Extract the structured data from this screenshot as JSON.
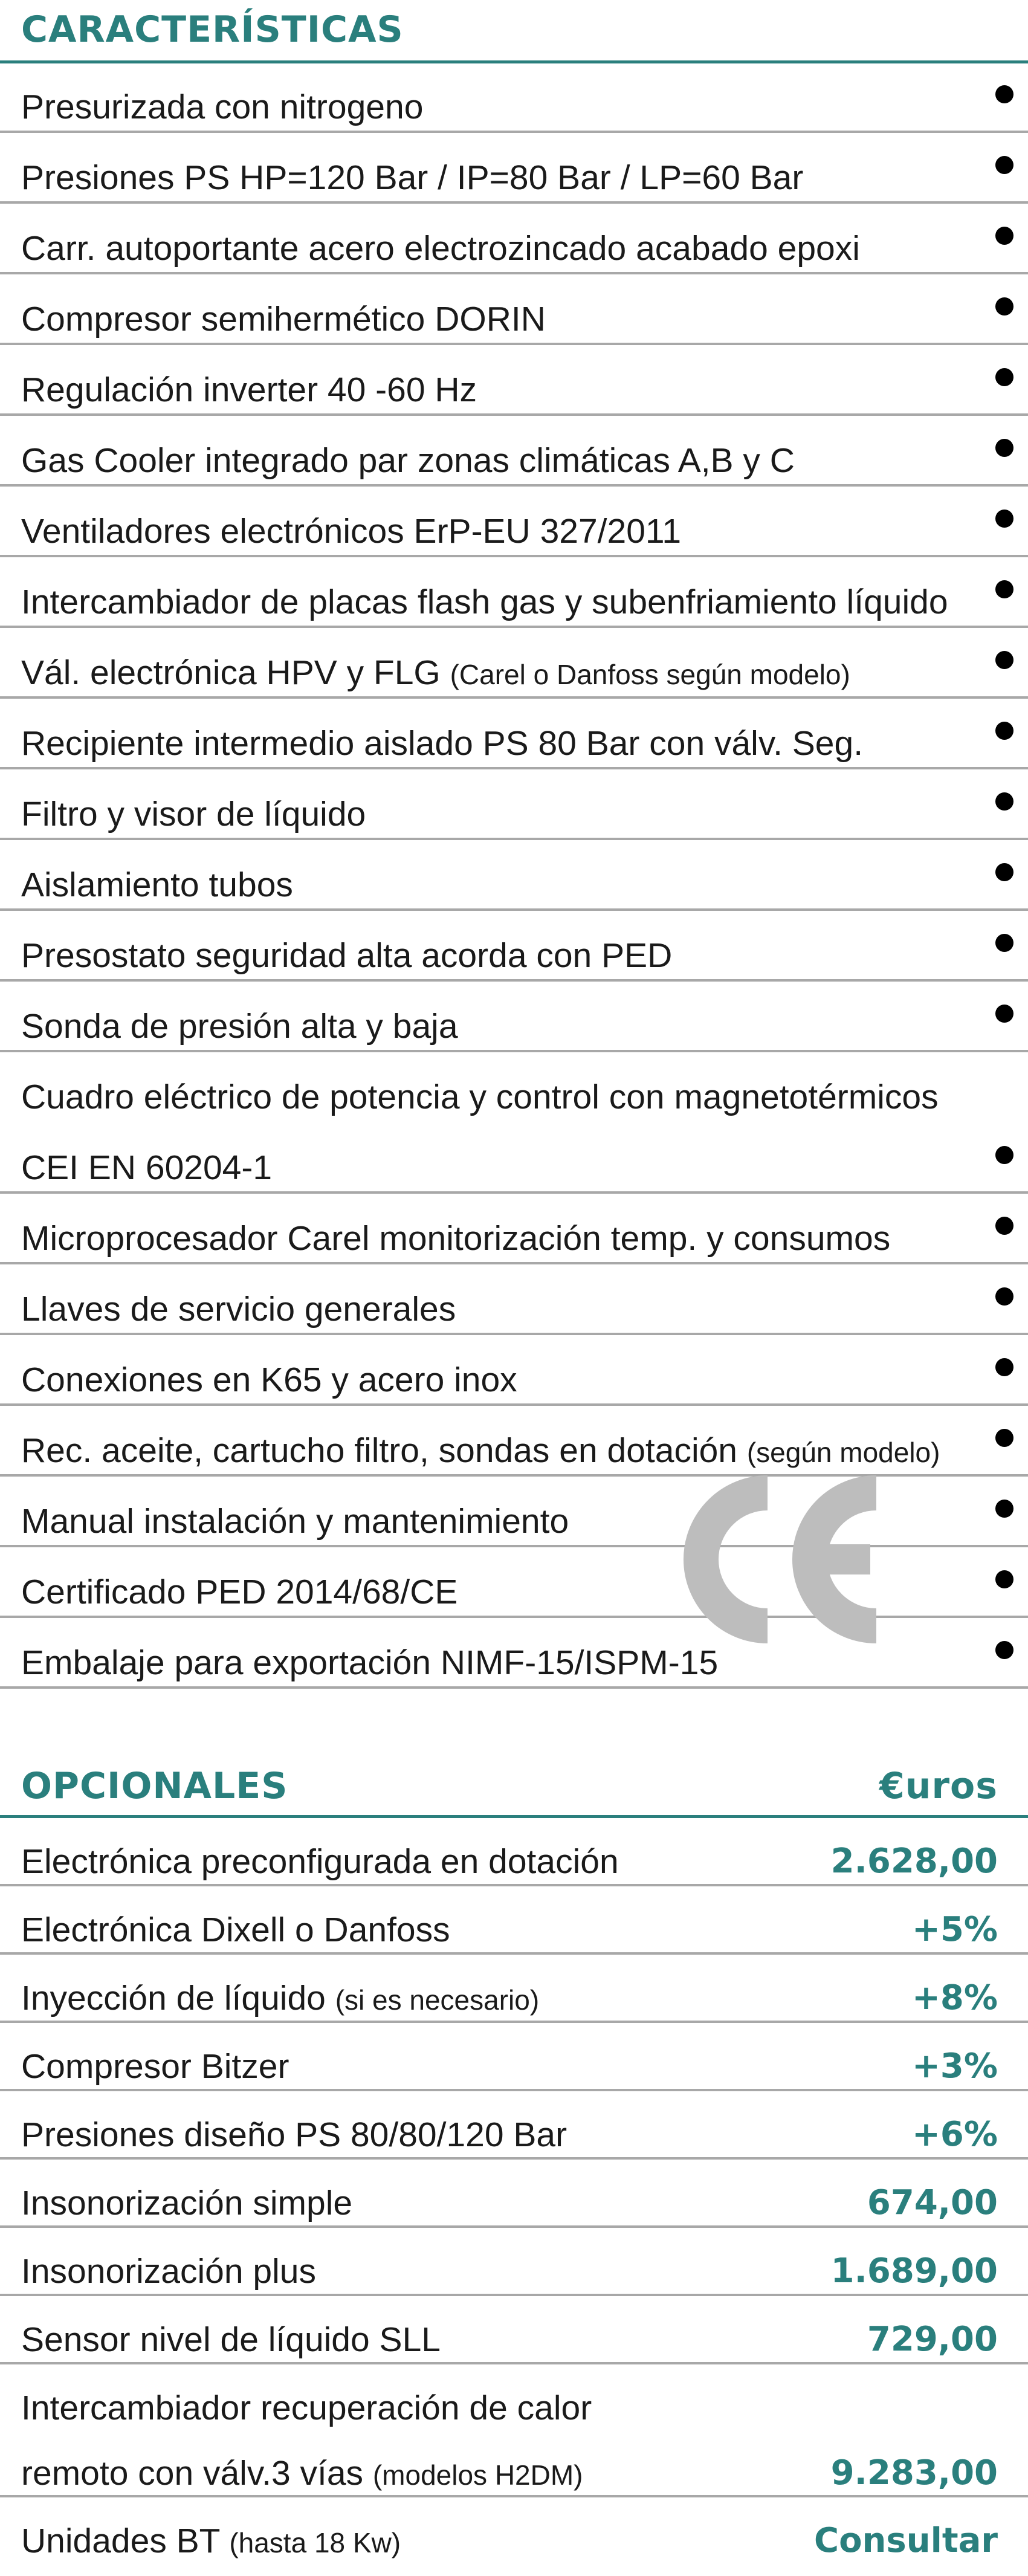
{
  "caracteristicas": {
    "title": "CARACTERÍSTICAS",
    "items": [
      {
        "text": "Presurizada con nitrogeno",
        "small": ""
      },
      {
        "text": "Presiones PS HP=120 Bar / IP=80 Bar / LP=60 Bar",
        "small": ""
      },
      {
        "text": "Carr. autoportante acero electrozincado acabado epoxi",
        "small": ""
      },
      {
        "text": "Compresor semihermético DORIN",
        "small": ""
      },
      {
        "text": "Regulación inverter 40 -60 Hz",
        "small": ""
      },
      {
        "text": "Gas Cooler integrado par zonas climáticas A,B y C",
        "small": ""
      },
      {
        "text": "Ventiladores electrónicos ErP-EU 327/2011",
        "small": ""
      },
      {
        "text": "Intercambiador de placas flash gas y subenfriamiento líquido",
        "small": ""
      },
      {
        "text": "Vál. electrónica  HPV y FLG ",
        "small": "(Carel o Danfoss según modelo)"
      },
      {
        "text": "Recipiente intermedio aislado PS 80 Bar con válv. Seg.",
        "small": ""
      },
      {
        "text": "Filtro y visor de líquido",
        "small": ""
      },
      {
        "text": "Aislamiento tubos",
        "small": ""
      },
      {
        "text": "Presostato seguridad alta acorda con PED",
        "small": ""
      },
      {
        "text": "Sonda de presión alta y baja",
        "small": ""
      },
      {
        "text": "Cuadro eléctrico de potencia y control con magnetotérmicos",
        "text2": "CEI EN 60204-1",
        "small": ""
      },
      {
        "text": "Microprocesador Carel monitorización temp. y consumos",
        "small": ""
      },
      {
        "text": "Llaves de servicio generales",
        "small": ""
      },
      {
        "text": "Conexiones en K65 y acero inox",
        "small": ""
      },
      {
        "text": "Rec. aceite, cartucho filtro, sondas en dotación ",
        "small": "(según modelo)"
      },
      {
        "text": "Manual instalación y mantenimiento",
        "small": ""
      },
      {
        "text": "Certificado PED 2014/68/CE",
        "small": ""
      },
      {
        "text": "Embalaje para exportación NIMF-15/ISPM-15",
        "small": ""
      }
    ]
  },
  "opcionales": {
    "title": "OPCIONALES",
    "currency_label": "€uros",
    "items": [
      {
        "text": "Electrónica preconfigurada en dotación",
        "small": "",
        "value": "2.628,00"
      },
      {
        "text": "Electrónica Dixell o Danfoss",
        "small": "",
        "value": "+5%"
      },
      {
        "text": "Inyección de líquido ",
        "small": "(si es necesario)",
        "value": "+8%"
      },
      {
        "text": "Compresor Bitzer",
        "small": "",
        "value": "+3%"
      },
      {
        "text": "Presiones diseño PS 80/80/120 Bar",
        "small": "",
        "value": "+6%"
      },
      {
        "text": "Insonorización simple",
        "small": "",
        "value": "674,00"
      },
      {
        "text": "Insonorización plus",
        "small": "",
        "value": "1.689,00"
      },
      {
        "text": "Sensor nivel de líquido SLL",
        "small": "",
        "value": "729,00"
      },
      {
        "text": "Intercambiador recuperación de calor",
        "text2": "remoto con válv.3 vías ",
        "small": "(modelos H2DM)",
        "value": "9.283,00"
      },
      {
        "text": "Unidades BT ",
        "small": "(hasta 18 Kw)",
        "value": "Consultar"
      }
    ]
  },
  "colors": {
    "accent": "#2a7f7d",
    "divider": "#a8a8a8",
    "ce_mark": "#bdbdbd"
  },
  "icons": {
    "ce_mark": "ce-mark-icon",
    "bullet": "bullet-dot-icon"
  }
}
